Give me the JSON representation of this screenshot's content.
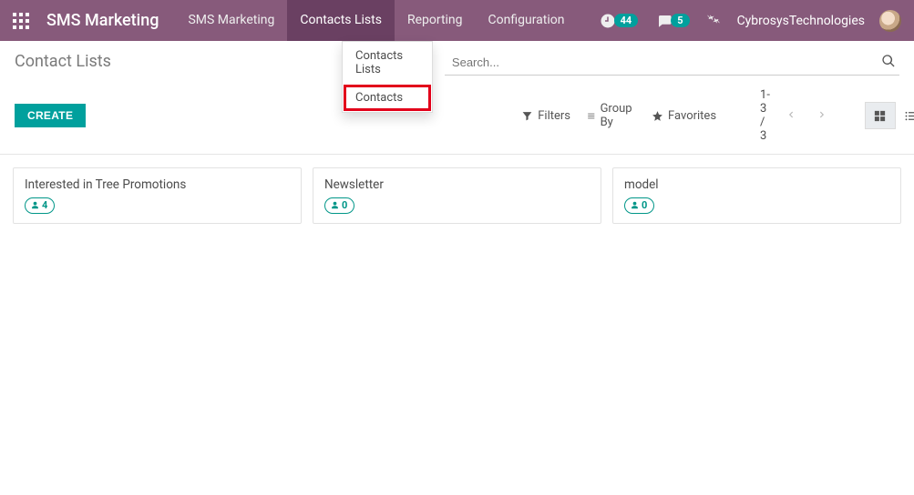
{
  "topbar": {
    "brand": "SMS Marketing",
    "nav": [
      {
        "label": "SMS Marketing"
      },
      {
        "label": "Contacts Lists",
        "active": true
      },
      {
        "label": "Reporting"
      },
      {
        "label": "Configuration"
      }
    ],
    "activity_count": "44",
    "chat_count": "5",
    "user": "CybrosysTechnologies"
  },
  "dropdown": {
    "items": [
      {
        "label": "Contacts Lists"
      },
      {
        "label": "Contacts",
        "highlight": true
      }
    ]
  },
  "panel": {
    "breadcrumb": "Contact Lists",
    "search_placeholder": "Search...",
    "create_label": "CREATE",
    "filters_label": "Filters",
    "groupby_label": "Group By",
    "favorites_label": "Favorites",
    "pager": "1-3 / 3"
  },
  "cards": [
    {
      "title": "Interested in Tree Promotions",
      "count": "4"
    },
    {
      "title": "Newsletter",
      "count": "0"
    },
    {
      "title": "model",
      "count": "0"
    }
  ]
}
